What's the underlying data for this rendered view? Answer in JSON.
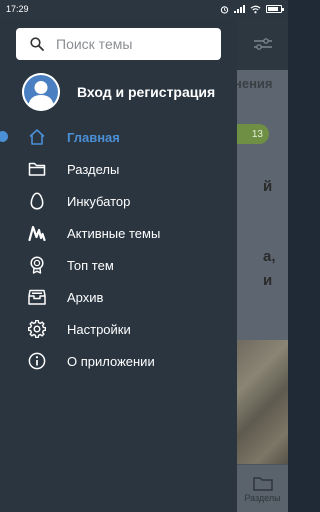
{
  "status_bar": {
    "time": "17:29",
    "icons": [
      "alarm-icon",
      "signal-icon",
      "wifi-icon",
      "battery-icon"
    ]
  },
  "drawer": {
    "search": {
      "placeholder": "Поиск темы",
      "value": ""
    },
    "account": {
      "label": "Вход и регистрация",
      "avatar_icon": "user-avatar-icon"
    },
    "menu": [
      {
        "label": "Главная",
        "icon": "home-icon",
        "active": true
      },
      {
        "label": "Разделы",
        "icon": "folder-icon",
        "active": false
      },
      {
        "label": "Инкубатор",
        "icon": "egg-icon",
        "active": false
      },
      {
        "label": "Активные темы",
        "icon": "activity-icon",
        "active": false
      },
      {
        "label": "Топ тем",
        "icon": "award-icon",
        "active": false
      },
      {
        "label": "Архив",
        "icon": "archive-icon",
        "active": false
      },
      {
        "label": "Настройки",
        "icon": "gear-icon",
        "active": false
      },
      {
        "label": "О приложении",
        "icon": "info-icon",
        "active": false
      }
    ]
  },
  "background": {
    "header_text": "нения",
    "badge": "13",
    "line1": "й",
    "line2": "а,",
    "line3": "и",
    "nav_label": "Разделы"
  },
  "colors": {
    "drawer_bg": "#2a3540",
    "accent": "#4b8fd6",
    "badge_green": "#6f8f45"
  }
}
